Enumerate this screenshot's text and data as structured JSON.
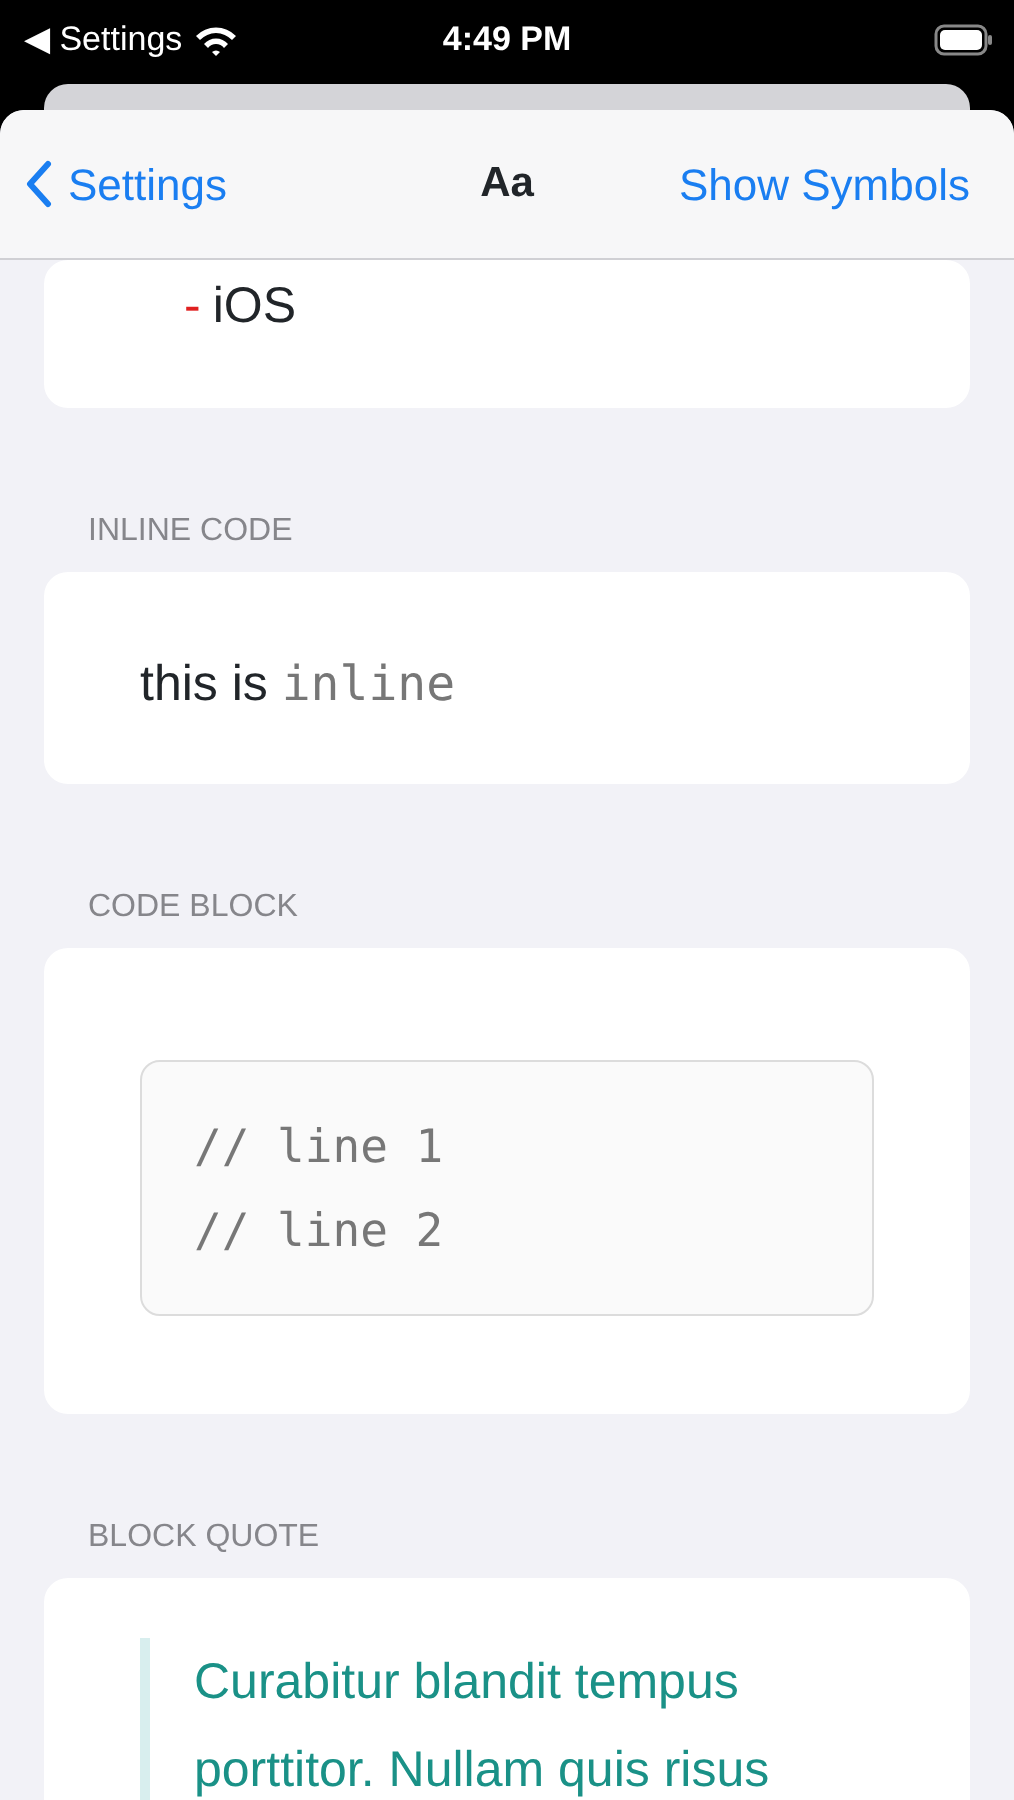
{
  "status_bar": {
    "back_label": "◀ Settings",
    "time": "4:49 PM"
  },
  "nav_bar": {
    "back": "Settings",
    "title": "Aa",
    "action": "Show Symbols"
  },
  "sections": [
    {
      "kind": "list",
      "items": [
        {
          "marker": "-",
          "text": "iOS"
        }
      ]
    },
    {
      "kind": "inline",
      "header": "INLINE CODE",
      "text": "this is",
      "code": "inline"
    },
    {
      "kind": "codeblock",
      "header": "CODE BLOCK",
      "lines": [
        "// line 1",
        "// line 2"
      ]
    },
    {
      "kind": "quote",
      "header": "BLOCK QUOTE",
      "text": "Curabitur blandit tempus porttitor. Nullam quis risus"
    }
  ]
}
